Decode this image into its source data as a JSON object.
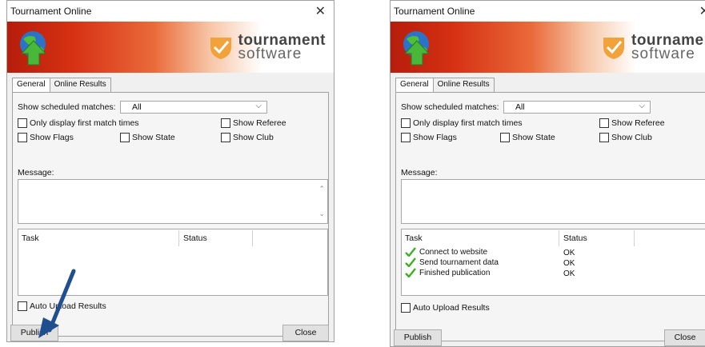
{
  "left_window": {
    "title": "Tournament Online",
    "brand": {
      "line1": "tournament",
      "line2": "software"
    },
    "tabs": [
      {
        "label": "General",
        "active": true
      },
      {
        "label": "Online Results",
        "active": false
      }
    ],
    "show_scheduled_label": "Show scheduled matches:",
    "show_scheduled_value": "All",
    "options": {
      "only_first": "Only display first match times",
      "show_referee": "Show Referee",
      "show_flags": "Show Flags",
      "show_state": "Show State",
      "show_club": "Show Club"
    },
    "message_label": "Message:",
    "task_header": "Task",
    "status_header": "Status",
    "tasks": [],
    "auto_upload": "Auto Upload Results",
    "publish": "Publish",
    "close": "Close"
  },
  "right_window": {
    "title": "Tournament Online",
    "brand": {
      "line1": "tournament",
      "line2": "software"
    },
    "tabs": [
      {
        "label": "General",
        "active": true
      },
      {
        "label": "Online Results",
        "active": false
      }
    ],
    "show_scheduled_label": "Show scheduled matches:",
    "show_scheduled_value": "All",
    "options": {
      "only_first": "Only display first match times",
      "show_referee": "Show Referee",
      "show_flags": "Show Flags",
      "show_state": "Show State",
      "show_club": "Show Club"
    },
    "message_label": "Message:",
    "task_header": "Task",
    "status_header": "Status",
    "tasks": [
      {
        "name": "Connect to website",
        "status": "OK"
      },
      {
        "name": "Send tournament data",
        "status": "OK"
      },
      {
        "name": "Finished publication",
        "status": "OK"
      }
    ],
    "auto_upload": "Auto Upload Results",
    "publish": "Publish",
    "close": "Close"
  },
  "colors": {
    "banner_red": "#c8230d",
    "check_green": "#3fae29",
    "arrow_blue": "#1f4f8f"
  },
  "icons": {
    "globe": "globe-upload-icon",
    "brand": "tournament-software-logo",
    "check": "green-check-icon",
    "pointer": "annotation-arrow"
  }
}
